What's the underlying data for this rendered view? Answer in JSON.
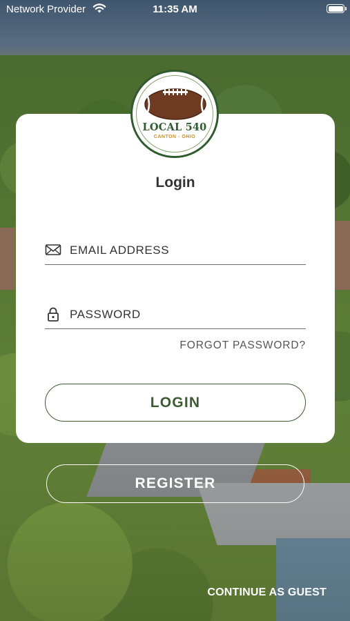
{
  "status_bar": {
    "carrier": "Network Provider",
    "time": "11:35 AM"
  },
  "logo": {
    "title": "LOCAL 540",
    "subtitle": "CANTON - OHIO",
    "colors": {
      "green": "#2f5b2f",
      "gold": "#c8922c",
      "ball": "#6e3a22"
    }
  },
  "login": {
    "title": "Login",
    "email": {
      "label": "EMAIL ADDRESS",
      "icon": "envelope-icon"
    },
    "password": {
      "label": "PASSWORD",
      "icon": "lock-icon"
    },
    "forgot_label": "FORGOT PASSWORD?",
    "login_button": "LOGIN",
    "accent_color": "#3c5b32"
  },
  "register_button": "REGISTER",
  "guest_link": "CONTINUE AS GUEST"
}
